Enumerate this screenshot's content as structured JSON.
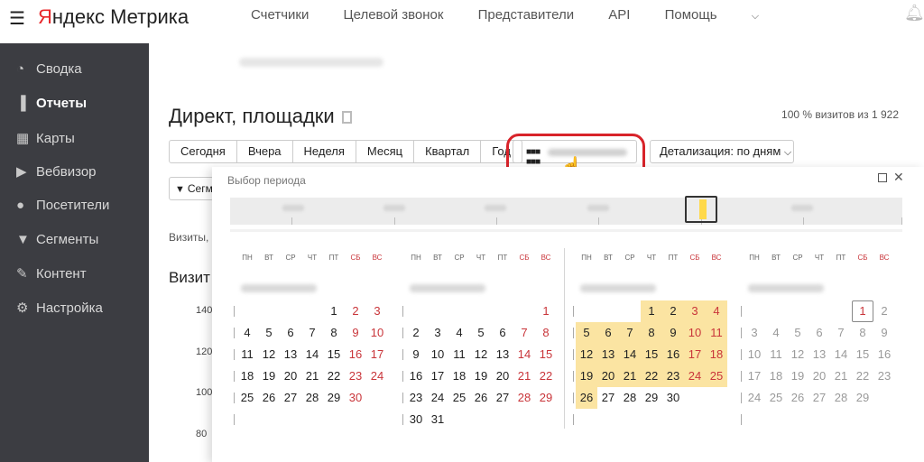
{
  "header": {
    "logo_first": "Я",
    "logo_rest": "ндекс Метрика",
    "nav": [
      "Счетчики",
      "Целевой звонок",
      "Представители",
      "API",
      "Помощь"
    ]
  },
  "sidebar": {
    "items": [
      {
        "label": "Сводка",
        "icon": "dashboard-icon"
      },
      {
        "label": "Отчеты",
        "icon": "bar-chart-icon",
        "active": true
      },
      {
        "label": "Карты",
        "icon": "map-icon"
      },
      {
        "label": "Вебвизор",
        "icon": "play-icon"
      },
      {
        "label": "Посетители",
        "icon": "user-icon"
      },
      {
        "label": "Сегменты",
        "icon": "filter-icon"
      },
      {
        "label": "Контент",
        "icon": "pencil-icon"
      },
      {
        "label": "Настройка",
        "icon": "gear-icon"
      }
    ]
  },
  "report": {
    "title": "Директ, площадки",
    "visits_share": "100 % визитов из 1 922",
    "period_buttons": [
      "Сегодня",
      "Вчера",
      "Неделя",
      "Месяц",
      "Квартал",
      "Год"
    ],
    "detail": "Детализация: по дням",
    "segment_button": "Сегм",
    "visits_label": "Визиты,",
    "visits_heading": "Визит",
    "y_ticks": [
      "140",
      "120",
      "100",
      "80"
    ]
  },
  "popup": {
    "title": "Выбор периода",
    "weekdays": [
      "ПН",
      "ВТ",
      "СР",
      "ЧТ",
      "ПТ",
      "СБ",
      "ВС"
    ],
    "months": [
      {
        "offset": 4,
        "days": 30,
        "selected": []
      },
      {
        "offset": 6,
        "days": 31,
        "selected": []
      },
      {
        "offset": 3,
        "days": 30,
        "selected": [
          1,
          2,
          3,
          4,
          5,
          6,
          7,
          8,
          9,
          10,
          11,
          12,
          13,
          14,
          15,
          16,
          17,
          18,
          19,
          20,
          21,
          22,
          23,
          24,
          25,
          26
        ]
      },
      {
        "offset": 5,
        "days": 29,
        "selected": [],
        "today": 1,
        "dim_from": 2
      }
    ]
  },
  "colors": {
    "sidebar_bg": "#3c3d42",
    "weekend_red": "#c9353a",
    "selection_yellow": "#fbe4a2",
    "highlight_red": "#d8232a"
  }
}
